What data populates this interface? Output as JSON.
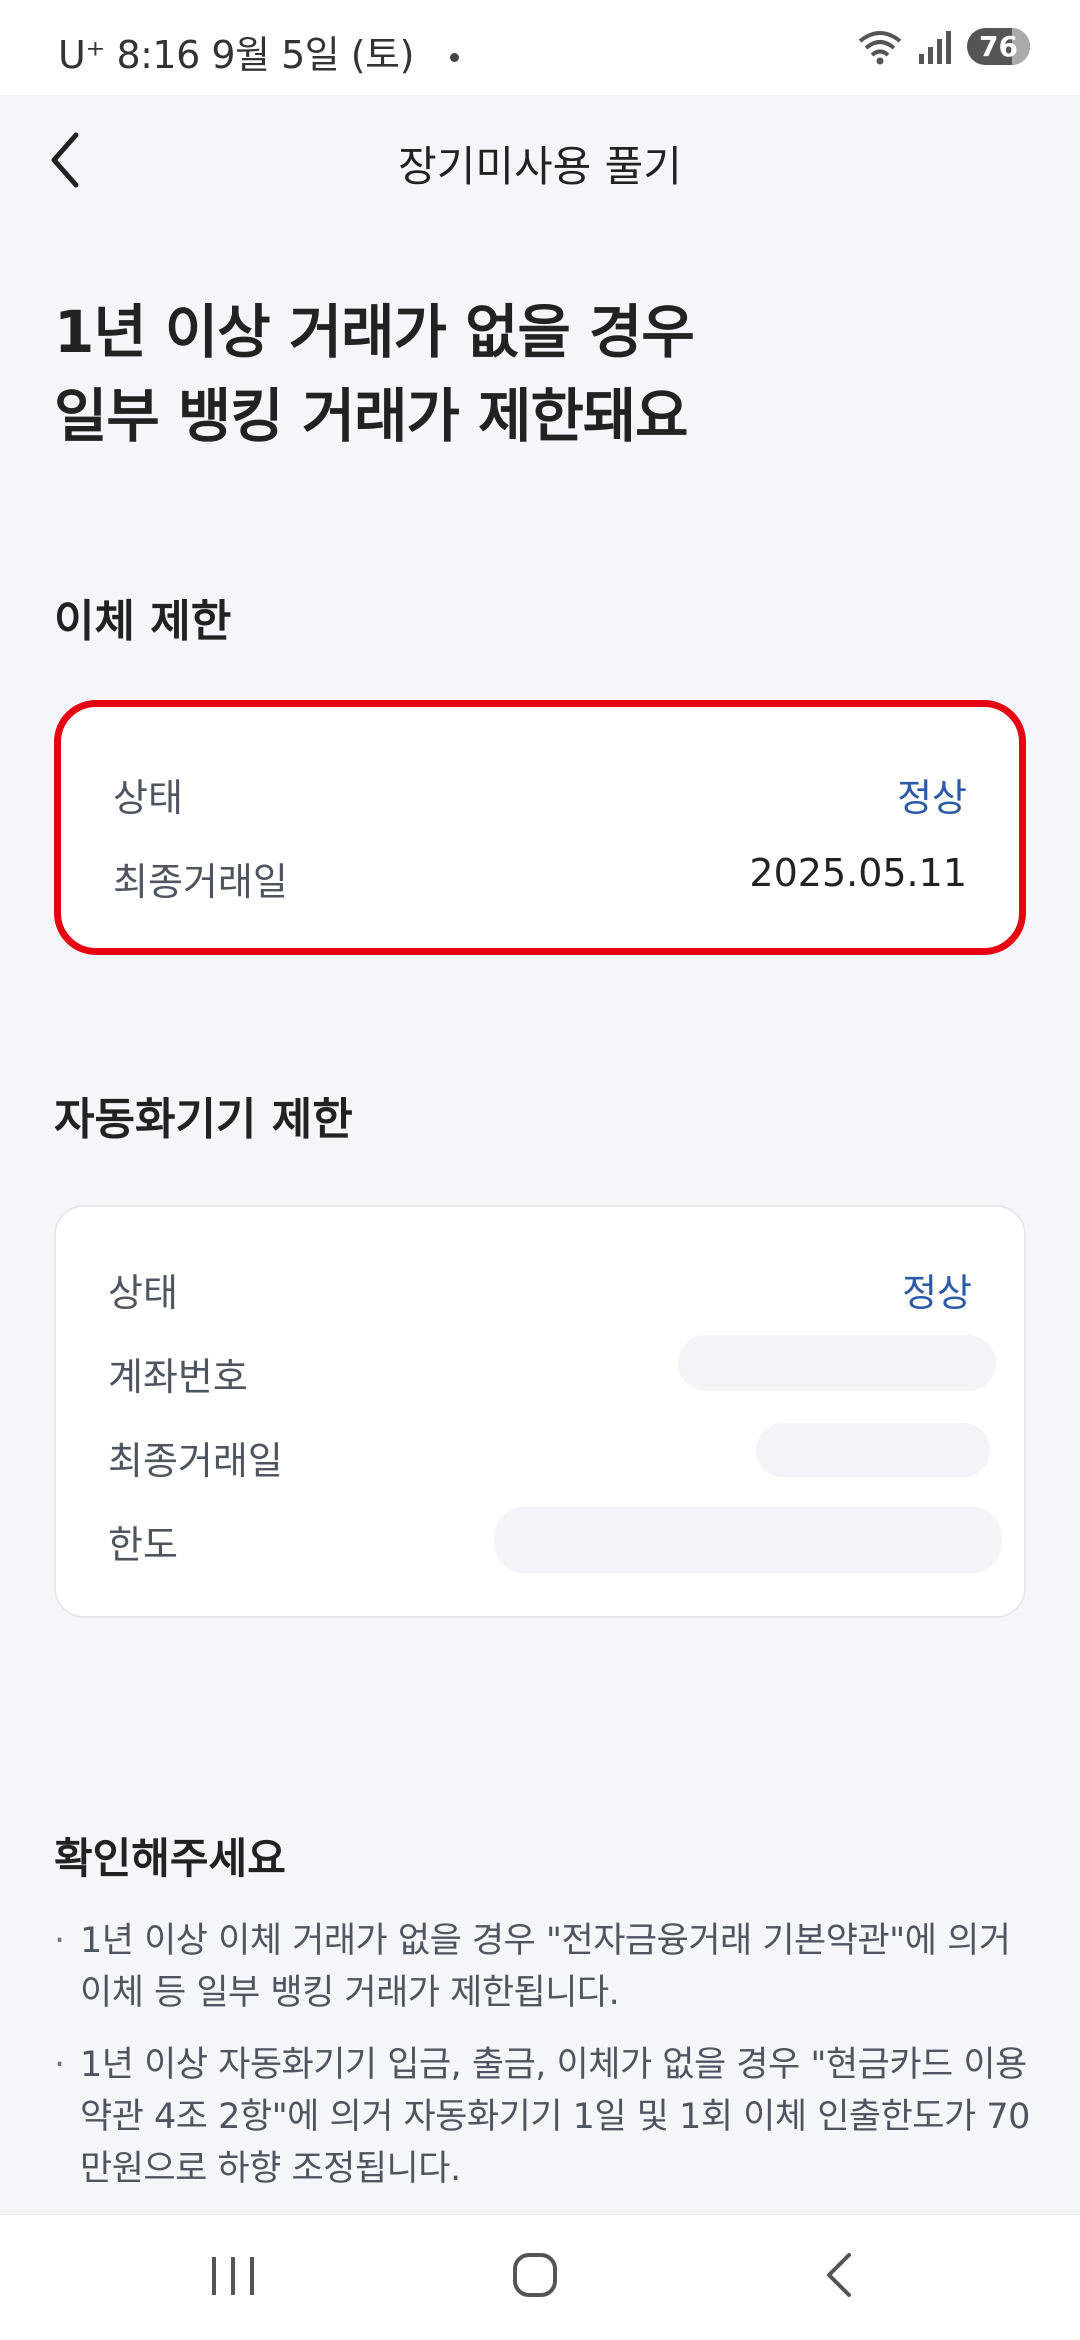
{
  "status_bar": {
    "carrier_time_date": "U⁺ 8:16  9월 5일 (토)",
    "battery": "76",
    "icons": [
      "wifi-icon",
      "signal-icon",
      "battery-icon"
    ]
  },
  "header": {
    "title": "장기미사용 풀기",
    "back_icon": "chevron-left-icon"
  },
  "headline": {
    "line1": "1년 이상 거래가 없을 경우",
    "line2": "일부 뱅킹 거래가 제한돼요"
  },
  "transfer_section": {
    "title": "이체 제한",
    "status_label": "상태",
    "status_value": "정상",
    "last_tx_label": "최종거래일",
    "last_tx_value": "2025.05.11"
  },
  "atm_section": {
    "title": "자동화기기 제한",
    "status_label": "상태",
    "status_value": "정상",
    "account_label": "계좌번호",
    "last_tx_label": "최종거래일",
    "limit_label": "한도"
  },
  "notice": {
    "title": "확인해주세요",
    "items": [
      "1년 이상 이체 거래가 없을 경우 \"전자금융거래 기본약관\"에 의거 이체 등 일부 뱅킹 거래가 제한됩니다.",
      "1년 이상 자동화기기 입금, 출금, 이체가 없을 경우 \"현금카드 이용약관 4조 2항\"에 의거 자동화기기 1일 및 1회 이체 인출한도가 70만원으로 하향 조정됩니다."
    ]
  },
  "colors": {
    "accent_blue": "#2a5aa8",
    "highlight_red": "#e60012",
    "background": "#f5f6fa"
  }
}
